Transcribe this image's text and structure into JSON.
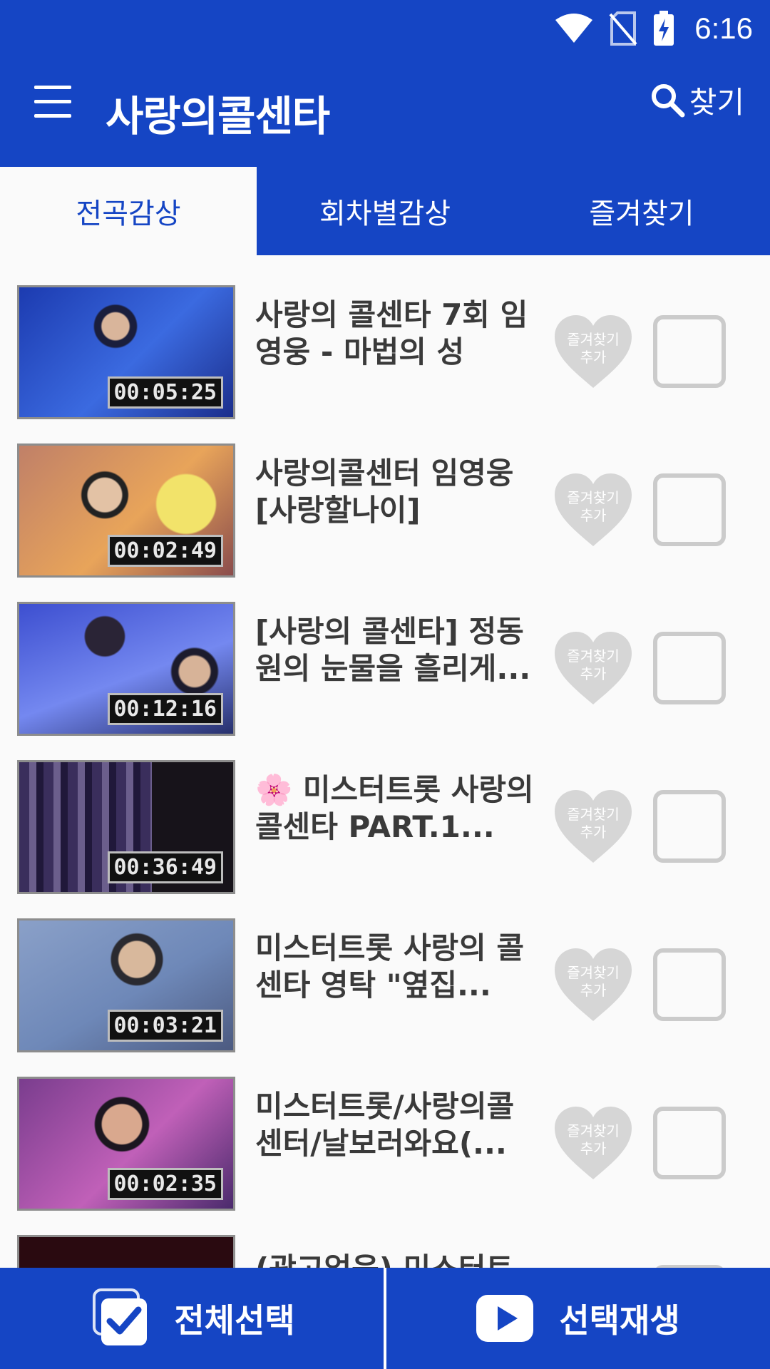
{
  "status_bar": {
    "time": "6:16"
  },
  "app_bar": {
    "title": "사랑의콜센타",
    "search_label": "찾기"
  },
  "tabs": [
    {
      "label": "전곡감상",
      "active": true
    },
    {
      "label": "회차별감상",
      "active": false
    },
    {
      "label": "즐겨찾기",
      "active": false
    }
  ],
  "favorite_label_line1": "즐겨찾기",
  "favorite_label_line2": "추가",
  "videos": [
    {
      "title": "사랑의 콜센타 7회 임영웅 - 마법의 성",
      "duration": "00:05:25"
    },
    {
      "title": "사랑의콜센터 임영웅 [사랑할나이]",
      "duration": "00:02:49"
    },
    {
      "title": "[사랑의 콜센타] 정동원의 눈물을 흘리게...",
      "duration": "00:12:16"
    },
    {
      "title": "미스터트롯 사랑의 콜센타 PART.1...",
      "prefix_icon": "🌸",
      "duration": "00:36:49"
    },
    {
      "title": "미스터트롯 사랑의 콜센타 영탁 \"옆집...",
      "duration": "00:03:21"
    },
    {
      "title": "미스터트롯/사랑의콜센터/날보러와요(...",
      "duration": "00:02:35"
    },
    {
      "title": "(광고없음) 미스터트",
      "duration": ""
    }
  ],
  "bottom_bar": {
    "select_all_label": "전체선택",
    "play_selected_label": "선택재생"
  },
  "colors": {
    "primary": "#1545c4",
    "heart": "#d6d6d6",
    "checkbox_border": "#cbcbcb"
  }
}
